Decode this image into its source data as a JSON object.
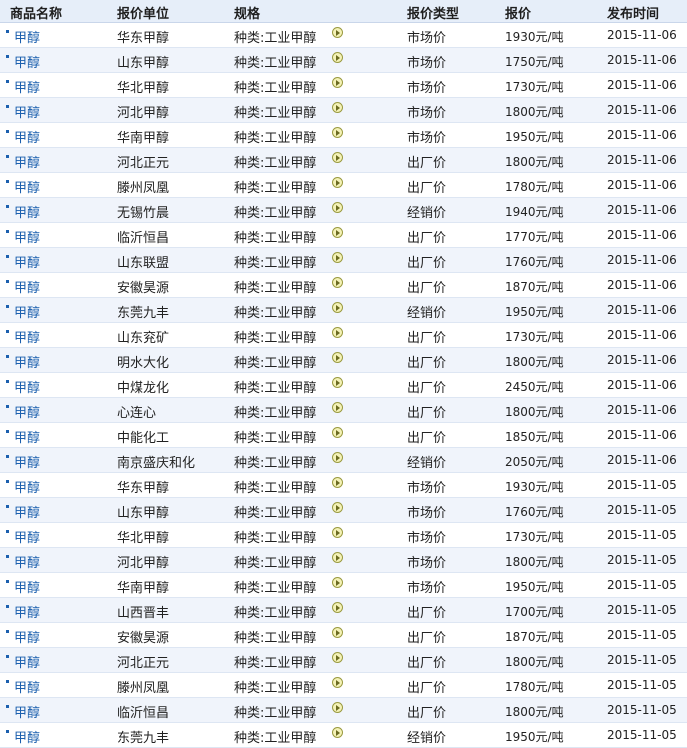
{
  "headers": {
    "name": "商品名称",
    "unit": "报价单位",
    "spec": "规格",
    "type": "报价类型",
    "price": "报价",
    "date": "发布时间"
  },
  "rows": [
    {
      "name": "甲醇",
      "unit": "华东甲醇",
      "spec": "种类:工业甲醇",
      "type": "市场价",
      "price": "1930元/吨",
      "date": "2015-11-06"
    },
    {
      "name": "甲醇",
      "unit": "山东甲醇",
      "spec": "种类:工业甲醇",
      "type": "市场价",
      "price": "1750元/吨",
      "date": "2015-11-06"
    },
    {
      "name": "甲醇",
      "unit": "华北甲醇",
      "spec": "种类:工业甲醇",
      "type": "市场价",
      "price": "1730元/吨",
      "date": "2015-11-06"
    },
    {
      "name": "甲醇",
      "unit": "河北甲醇",
      "spec": "种类:工业甲醇",
      "type": "市场价",
      "price": "1800元/吨",
      "date": "2015-11-06"
    },
    {
      "name": "甲醇",
      "unit": "华南甲醇",
      "spec": "种类:工业甲醇",
      "type": "市场价",
      "price": "1950元/吨",
      "date": "2015-11-06"
    },
    {
      "name": "甲醇",
      "unit": "河北正元",
      "spec": "种类:工业甲醇",
      "type": "出厂价",
      "price": "1800元/吨",
      "date": "2015-11-06"
    },
    {
      "name": "甲醇",
      "unit": "滕州凤凰",
      "spec": "种类:工业甲醇",
      "type": "出厂价",
      "price": "1780元/吨",
      "date": "2015-11-06"
    },
    {
      "name": "甲醇",
      "unit": "无锡竹晨",
      "spec": "种类:工业甲醇",
      "type": "经销价",
      "price": "1940元/吨",
      "date": "2015-11-06"
    },
    {
      "name": "甲醇",
      "unit": "临沂恒昌",
      "spec": "种类:工业甲醇",
      "type": "出厂价",
      "price": "1770元/吨",
      "date": "2015-11-06"
    },
    {
      "name": "甲醇",
      "unit": "山东联盟",
      "spec": "种类:工业甲醇",
      "type": "出厂价",
      "price": "1760元/吨",
      "date": "2015-11-06"
    },
    {
      "name": "甲醇",
      "unit": "安徽昊源",
      "spec": "种类:工业甲醇",
      "type": "出厂价",
      "price": "1870元/吨",
      "date": "2015-11-06"
    },
    {
      "name": "甲醇",
      "unit": "东莞九丰",
      "spec": "种类:工业甲醇",
      "type": "经销价",
      "price": "1950元/吨",
      "date": "2015-11-06"
    },
    {
      "name": "甲醇",
      "unit": "山东兖矿",
      "spec": "种类:工业甲醇",
      "type": "出厂价",
      "price": "1730元/吨",
      "date": "2015-11-06"
    },
    {
      "name": "甲醇",
      "unit": "明水大化",
      "spec": "种类:工业甲醇",
      "type": "出厂价",
      "price": "1800元/吨",
      "date": "2015-11-06"
    },
    {
      "name": "甲醇",
      "unit": "中煤龙化",
      "spec": "种类:工业甲醇",
      "type": "出厂价",
      "price": "2450元/吨",
      "date": "2015-11-06"
    },
    {
      "name": "甲醇",
      "unit": "心连心",
      "spec": "种类:工业甲醇",
      "type": "出厂价",
      "price": "1800元/吨",
      "date": "2015-11-06"
    },
    {
      "name": "甲醇",
      "unit": "中能化工",
      "spec": "种类:工业甲醇",
      "type": "出厂价",
      "price": "1850元/吨",
      "date": "2015-11-06"
    },
    {
      "name": "甲醇",
      "unit": "南京盛庆和化",
      "spec": "种类:工业甲醇",
      "type": "经销价",
      "price": "2050元/吨",
      "date": "2015-11-06"
    },
    {
      "name": "甲醇",
      "unit": "华东甲醇",
      "spec": "种类:工业甲醇",
      "type": "市场价",
      "price": "1930元/吨",
      "date": "2015-11-05"
    },
    {
      "name": "甲醇",
      "unit": "山东甲醇",
      "spec": "种类:工业甲醇",
      "type": "市场价",
      "price": "1760元/吨",
      "date": "2015-11-05"
    },
    {
      "name": "甲醇",
      "unit": "华北甲醇",
      "spec": "种类:工业甲醇",
      "type": "市场价",
      "price": "1730元/吨",
      "date": "2015-11-05"
    },
    {
      "name": "甲醇",
      "unit": "河北甲醇",
      "spec": "种类:工业甲醇",
      "type": "市场价",
      "price": "1800元/吨",
      "date": "2015-11-05"
    },
    {
      "name": "甲醇",
      "unit": "华南甲醇",
      "spec": "种类:工业甲醇",
      "type": "市场价",
      "price": "1950元/吨",
      "date": "2015-11-05"
    },
    {
      "name": "甲醇",
      "unit": "山西晋丰",
      "spec": "种类:工业甲醇",
      "type": "出厂价",
      "price": "1700元/吨",
      "date": "2015-11-05"
    },
    {
      "name": "甲醇",
      "unit": "安徽昊源",
      "spec": "种类:工业甲醇",
      "type": "出厂价",
      "price": "1870元/吨",
      "date": "2015-11-05"
    },
    {
      "name": "甲醇",
      "unit": "河北正元",
      "spec": "种类:工业甲醇",
      "type": "出厂价",
      "price": "1800元/吨",
      "date": "2015-11-05"
    },
    {
      "name": "甲醇",
      "unit": "滕州凤凰",
      "spec": "种类:工业甲醇",
      "type": "出厂价",
      "price": "1780元/吨",
      "date": "2015-11-05"
    },
    {
      "name": "甲醇",
      "unit": "临沂恒昌",
      "spec": "种类:工业甲醇",
      "type": "出厂价",
      "price": "1800元/吨",
      "date": "2015-11-05"
    },
    {
      "name": "甲醇",
      "unit": "东莞九丰",
      "spec": "种类:工业甲醇",
      "type": "经销价",
      "price": "1950元/吨",
      "date": "2015-11-05"
    }
  ],
  "icons": {
    "bullet": "bullet-icon",
    "go": "arrow-circle-icon"
  },
  "colors": {
    "header_bg": "#e6eef9",
    "row_alt_bg": "#f0f4fb",
    "link": "#1b5fae"
  }
}
